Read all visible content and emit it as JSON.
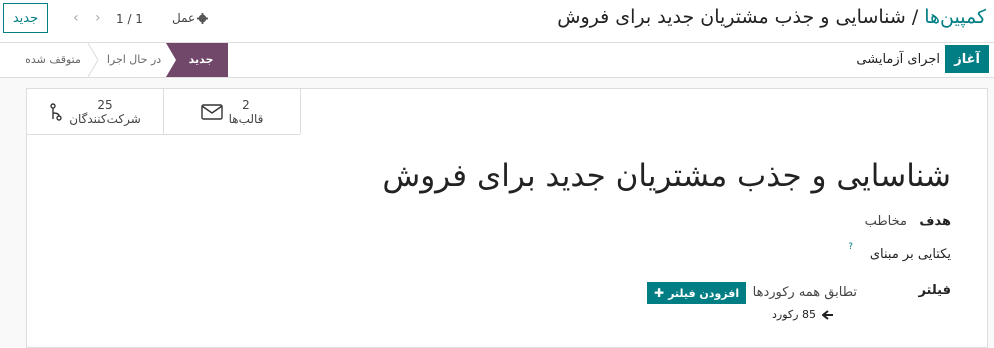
{
  "control_panel": {
    "new_button": "جدید",
    "pager_value": "1 / 1",
    "action_label": "عمل",
    "breadcrumb": {
      "parent": "کمپین‌ها",
      "separator": "/",
      "current": "شناسایی و جذب مشتریان جدید برای فروش"
    }
  },
  "status_bar": {
    "start_button": "آغاز",
    "test_button": "اجرای آزمایشی",
    "stages": [
      "جدید",
      "در حال اجرا",
      "متوقف شده"
    ],
    "active_stage": "جدید"
  },
  "stat_buttons": [
    {
      "count": "25",
      "label": "شرکت‌کنندگان",
      "icon": "sitemap-icon"
    },
    {
      "count": "2",
      "label": "قالب‌ها",
      "icon": "envelope-icon"
    }
  ],
  "form": {
    "title": "شناسایی و جذب مشتریان جدید برای فروش",
    "target_label": "هدف",
    "target_value": "مخاطب",
    "unique_label": "یکتایی بر مبنای",
    "unique_help": "?",
    "filter_label": "فیلتر",
    "filter_match_text": "تطابق همه رکوردها",
    "add_filter_button": "افزودن فیلتر",
    "record_count": "85 رکورد"
  },
  "colors": {
    "primary": "#017e84",
    "active_stage": "#71486a"
  }
}
